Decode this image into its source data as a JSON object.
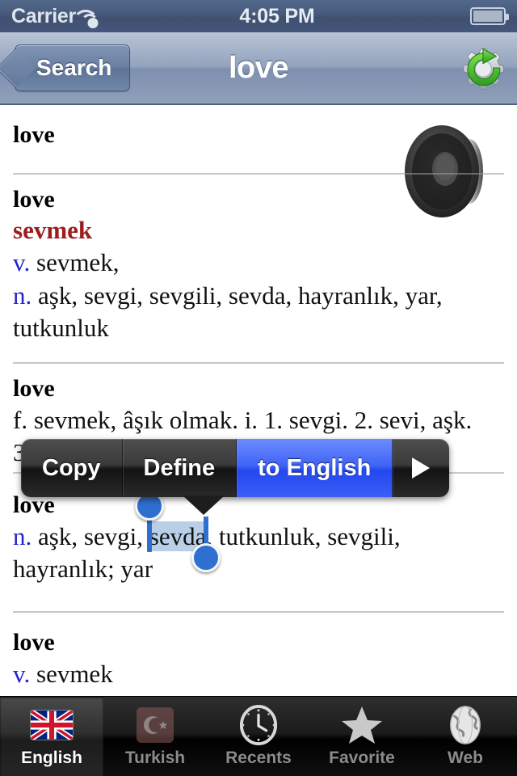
{
  "statusbar": {
    "carrier": "Carrier",
    "time": "4:05 PM",
    "wifi_icon": "wifi-icon",
    "battery_icon": "battery-icon"
  },
  "navbar": {
    "back_label": "Search",
    "title": "love",
    "gear_icon": "gear-refresh-icon"
  },
  "speaker_icon": "speaker-icon",
  "entries": [
    {
      "headword": "love",
      "lines": []
    },
    {
      "headword": "love",
      "lines": [
        {
          "pos": "",
          "text": "sevmek",
          "style": "red"
        },
        {
          "pos": "v.",
          "text": "sevmek,",
          "style": "normal"
        },
        {
          "pos": "n.",
          "text": "aşk, sevgi, sevgili, sevda, hayranlık, yar, tutkunluk",
          "style": "normal"
        }
      ]
    },
    {
      "headword": "love",
      "lines": [
        {
          "pos": "",
          "text": "f. sevmek, âşık olmak. i. 1. sevgi. 2. sevi, aşk.",
          "style": "normal"
        },
        {
          "pos": "",
          "text": "3",
          "style": "normal"
        }
      ]
    },
    {
      "headword": "love",
      "selection": {
        "before": "aşk, sevgi, ",
        "selected": "sevda",
        "after": ", tutkunluk, sevgili, hayranlık; yar",
        "pos": "n."
      },
      "lines": []
    },
    {
      "headword": "love",
      "lines": [
        {
          "pos": "v.",
          "text": "sevmek",
          "style": "normal"
        }
      ]
    }
  ],
  "callout": {
    "items": [
      {
        "label": "Copy",
        "highlighted": false
      },
      {
        "label": "Define",
        "highlighted": false
      },
      {
        "label": "to English",
        "highlighted": true
      }
    ],
    "more_icon": "play-arrow-icon"
  },
  "tabbar": {
    "tabs": [
      {
        "label": "English",
        "icon": "uk-flag-icon",
        "active": true
      },
      {
        "label": "Turkish",
        "icon": "turkey-flag-icon",
        "active": false
      },
      {
        "label": "Recents",
        "icon": "clock-icon",
        "active": false
      },
      {
        "label": "Favorite",
        "icon": "star-icon",
        "active": false
      },
      {
        "label": "Web",
        "icon": "globe-icon",
        "active": false
      }
    ]
  },
  "colors": {
    "accent_blue": "#2348ef",
    "headword": "#000000",
    "translation_red": "#9c1d1d",
    "pos_blue": "#2323cc",
    "selection_fill": "#b9cfe8",
    "navbar": "#7d90ae"
  }
}
